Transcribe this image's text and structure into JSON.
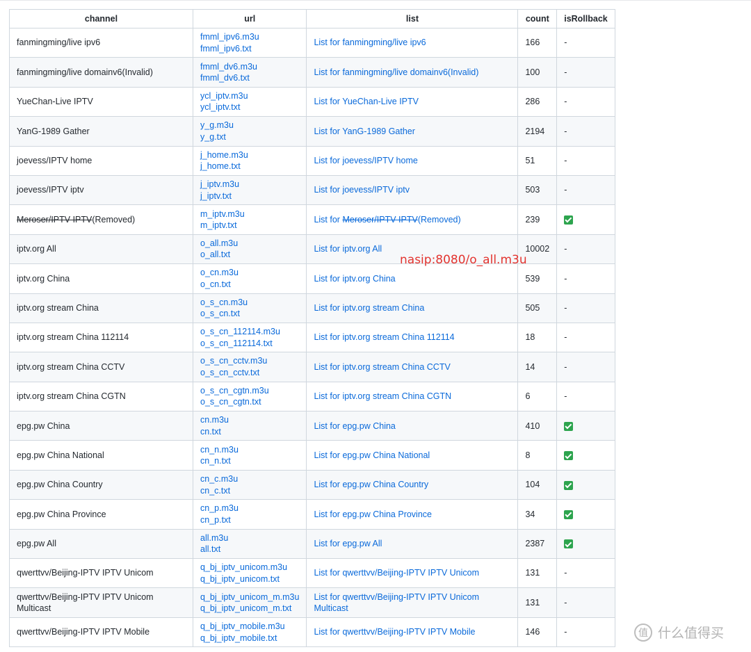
{
  "table": {
    "headers": [
      "channel",
      "url",
      "list",
      "count",
      "isRollback"
    ],
    "rows": [
      {
        "channel": "fanmingming/live ipv6",
        "url1": "fmml_ipv6.m3u",
        "url2": "fmml_ipv6.txt",
        "list": "List for fanmingming/live ipv6",
        "count": "166",
        "rollback": false
      },
      {
        "channel": "fanmingming/live domainv6(Invalid)",
        "url1": "fmml_dv6.m3u",
        "url2": "fmml_dv6.txt",
        "list": "List for fanmingming/live domainv6(Invalid)",
        "count": "100",
        "rollback": false
      },
      {
        "channel": "YueChan-Live IPTV",
        "url1": "ycl_iptv.m3u",
        "url2": "ycl_iptv.txt",
        "list": "List for YueChan-Live IPTV",
        "count": "286",
        "rollback": false
      },
      {
        "channel": "YanG-1989 Gather",
        "url1": "y_g.m3u",
        "url2": "y_g.txt",
        "list": "List for YanG-1989 Gather",
        "count": "2194",
        "rollback": false
      },
      {
        "channel": "joevess/IPTV home",
        "url1": "j_home.m3u",
        "url2": "j_home.txt",
        "list": "List for joevess/IPTV home",
        "count": "51",
        "rollback": false
      },
      {
        "channel": "joevess/IPTV iptv",
        "url1": "j_iptv.m3u",
        "url2": "j_iptv.txt",
        "list": "List for joevess/IPTV iptv",
        "count": "503",
        "rollback": false
      },
      {
        "channel_struck": "Meroser/IPTV IPTV",
        "channel_suffix": "(Removed)",
        "url1": "m_iptv.m3u",
        "url2": "m_iptv.txt",
        "list_prefix": "List for ",
        "list_struck": "Meroser/IPTV IPTV",
        "list_suffix": "(Removed)",
        "count": "239",
        "rollback": true
      },
      {
        "channel": "iptv.org All",
        "url1": "o_all.m3u",
        "url2": "o_all.txt",
        "list": "List for iptv.org All",
        "count": "10002",
        "rollback": false
      },
      {
        "channel": "iptv.org China",
        "url1": "o_cn.m3u",
        "url2": "o_cn.txt",
        "list": "List for iptv.org China",
        "count": "539",
        "rollback": false
      },
      {
        "channel": "iptv.org stream China",
        "url1": "o_s_cn.m3u",
        "url2": "o_s_cn.txt",
        "list": "List for iptv.org stream China",
        "count": "505",
        "rollback": false
      },
      {
        "channel": "iptv.org stream China 112114",
        "url1": "o_s_cn_112114.m3u",
        "url2": "o_s_cn_112114.txt",
        "list": "List for iptv.org stream China 112114",
        "count": "18",
        "rollback": false
      },
      {
        "channel": "iptv.org stream China CCTV",
        "url1": "o_s_cn_cctv.m3u",
        "url2": "o_s_cn_cctv.txt",
        "list": "List for iptv.org stream China CCTV",
        "count": "14",
        "rollback": false
      },
      {
        "channel": "iptv.org stream China CGTN",
        "url1": "o_s_cn_cgtn.m3u",
        "url2": "o_s_cn_cgtn.txt",
        "list": "List for iptv.org stream China CGTN",
        "count": "6",
        "rollback": false
      },
      {
        "channel": "epg.pw China",
        "url1": "cn.m3u",
        "url2": "cn.txt",
        "list": "List for epg.pw China",
        "count": "410",
        "rollback": true
      },
      {
        "channel": "epg.pw China National",
        "url1": "cn_n.m3u",
        "url2": "cn_n.txt",
        "list": "List for epg.pw China National",
        "count": "8",
        "rollback": true
      },
      {
        "channel": "epg.pw China Country",
        "url1": "cn_c.m3u",
        "url2": "cn_c.txt",
        "list": "List for epg.pw China Country",
        "count": "104",
        "rollback": true
      },
      {
        "channel": "epg.pw China Province",
        "url1": "cn_p.m3u",
        "url2": "cn_p.txt",
        "list": "List for epg.pw China Province",
        "count": "34",
        "rollback": true
      },
      {
        "channel": "epg.pw All",
        "url1": "all.m3u",
        "url2": "all.txt",
        "list": "List for epg.pw All",
        "count": "2387",
        "rollback": true
      },
      {
        "channel": "qwerttvv/Beijing-IPTV IPTV Unicom",
        "url1": "q_bj_iptv_unicom.m3u",
        "url2": "q_bj_iptv_unicom.txt",
        "list": "List for qwerttvv/Beijing-IPTV IPTV Unicom",
        "count": "131",
        "rollback": false
      },
      {
        "channel": "qwerttvv/Beijing-IPTV IPTV Unicom Multicast",
        "url1": "q_bj_iptv_unicom_m.m3u",
        "url2": "q_bj_iptv_unicom_m.txt",
        "list": "List for qwerttvv/Beijing-IPTV IPTV Unicom Multicast",
        "count": "131",
        "rollback": false
      },
      {
        "channel": "qwerttvv/Beijing-IPTV IPTV Mobile",
        "url1": "q_bj_iptv_mobile.m3u",
        "url2": "q_bj_iptv_mobile.txt",
        "list": "List for qwerttvv/Beijing-IPTV IPTV Mobile",
        "count": "146",
        "rollback": false
      }
    ],
    "rollback_false_text": "-"
  },
  "annotation": {
    "text": "nasip:8080/o_all.m3u",
    "color": "#e3342f"
  },
  "watermark": {
    "text": "什么值得买",
    "icon_glyph": "值"
  },
  "colors": {
    "link": "#0969da",
    "check": "#2da44e",
    "border": "#d0d7de",
    "stripe": "#f6f8fa"
  }
}
